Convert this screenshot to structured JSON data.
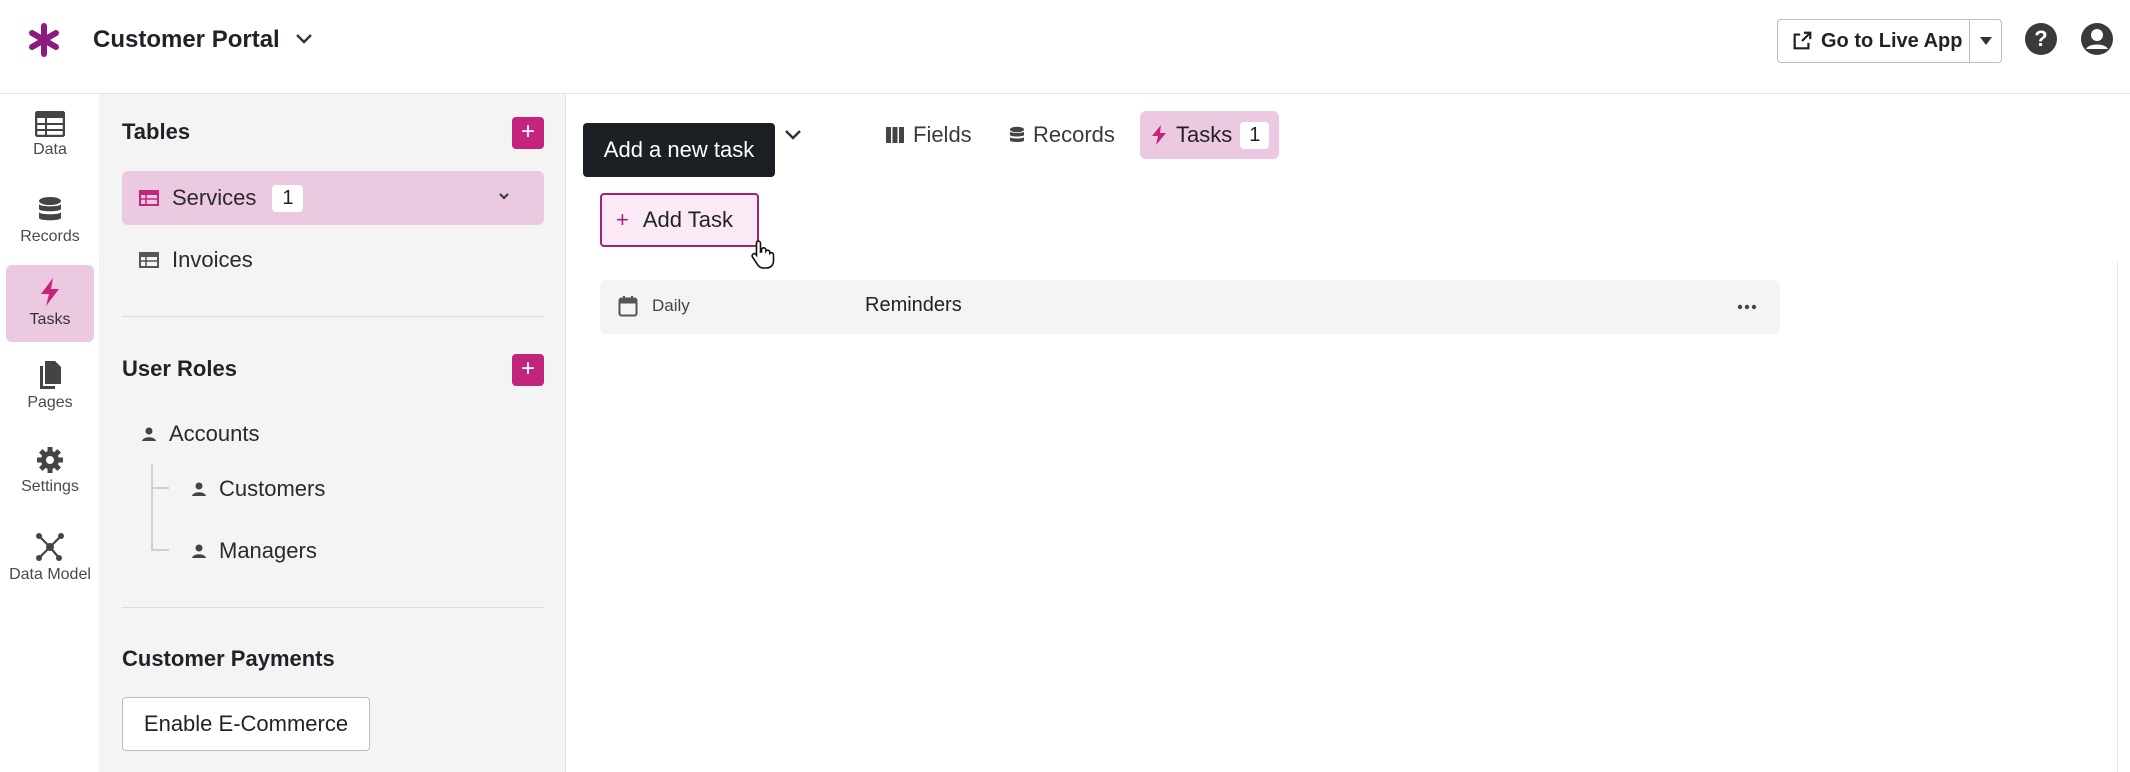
{
  "topbar": {
    "app_title": "Customer Portal",
    "live_button": "Go to Live App",
    "icons": [
      "asterisk-logo-icon",
      "chevron-down-icon",
      "external-link-icon",
      "caret-down-icon",
      "help-icon",
      "user-account-icon"
    ],
    "brand_color": "#8d1a7e"
  },
  "leftnav": {
    "items": [
      {
        "label": "Data",
        "icon": "table-icon"
      },
      {
        "label": "Records",
        "icon": "database-icon"
      },
      {
        "label": "Tasks",
        "icon": "bolt-icon",
        "active": true
      },
      {
        "label": "Pages",
        "icon": "pages-icon"
      },
      {
        "label": "Settings",
        "icon": "gear-icon"
      },
      {
        "label": "Data Model",
        "icon": "network-icon"
      }
    ]
  },
  "sidebar": {
    "tables_title": "Tables",
    "tables": [
      {
        "label": "Services",
        "count": "1",
        "active": true
      },
      {
        "label": "Invoices"
      }
    ],
    "roles_title": "User Roles",
    "roles": [
      {
        "label": "Accounts"
      },
      {
        "label": "Customers"
      },
      {
        "label": "Managers"
      }
    ],
    "payments_title": "Customer Payments",
    "ecommerce_button": "Enable E-Commerce",
    "accent_color": "#c2247e"
  },
  "main": {
    "tooltip": "Add a new task",
    "tabs": [
      {
        "label": "Fields",
        "icon": "columns-icon"
      },
      {
        "label": "Records",
        "icon": "database-icon"
      },
      {
        "label": "Tasks",
        "icon": "bolt-icon",
        "count": "1",
        "active": true
      }
    ],
    "add_task_button": "Add Task",
    "add_task_plus": "+",
    "tasks": [
      {
        "schedule": "Daily",
        "name": "Reminders"
      }
    ]
  }
}
